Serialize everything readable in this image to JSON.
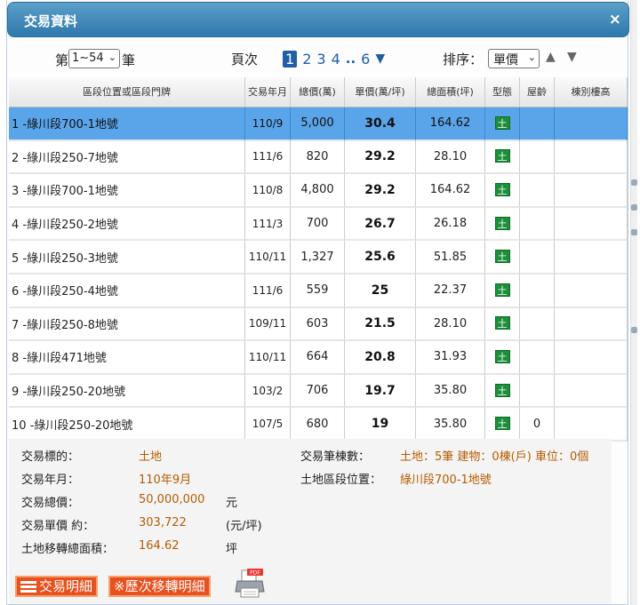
{
  "dialog": {
    "title": "交易資料",
    "close_glyph": "×"
  },
  "pager": {
    "prefix": "第",
    "range_value": "1~54",
    "suffix": "筆",
    "page_label": "頁次",
    "pages": [
      "1",
      "2",
      "3",
      "4",
      "..",
      "6"
    ],
    "current_page": "1",
    "next_glyph": "▼",
    "sort_label": "排序：",
    "sort_value": "單價",
    "sort_up_glyph": "▲",
    "sort_down_glyph": "▼"
  },
  "table": {
    "headers": [
      "區段位置或區段門牌",
      "交易年月",
      "總價(萬)",
      "單價(萬/坪)",
      "總面積(坪)",
      "型態",
      "屋齡",
      "棟別樓高"
    ],
    "rows": [
      {
        "no": "1",
        "addr": "-綠川段700-1地號",
        "ym": "110/9",
        "total": "5,000",
        "unit": "30.4",
        "area": "164.62",
        "type": "土",
        "age": "",
        "floor": ""
      },
      {
        "no": "2",
        "addr": "-綠川段250-7地號",
        "ym": "111/6",
        "total": "820",
        "unit": "29.2",
        "area": "28.10",
        "type": "土",
        "age": "",
        "floor": ""
      },
      {
        "no": "3",
        "addr": "-綠川段700-1地號",
        "ym": "110/8",
        "total": "4,800",
        "unit": "29.2",
        "area": "164.62",
        "type": "土",
        "age": "",
        "floor": ""
      },
      {
        "no": "4",
        "addr": "-綠川段250-2地號",
        "ym": "111/3",
        "total": "700",
        "unit": "26.7",
        "area": "26.18",
        "type": "土",
        "age": "",
        "floor": ""
      },
      {
        "no": "5",
        "addr": "-綠川段250-3地號",
        "ym": "110/11",
        "total": "1,327",
        "unit": "25.6",
        "area": "51.85",
        "type": "土",
        "age": "",
        "floor": ""
      },
      {
        "no": "6",
        "addr": "-綠川段250-4地號",
        "ym": "111/6",
        "total": "559",
        "unit": "25",
        "area": "22.37",
        "type": "土",
        "age": "",
        "floor": ""
      },
      {
        "no": "7",
        "addr": "-綠川段250-8地號",
        "ym": "109/11",
        "total": "603",
        "unit": "21.5",
        "area": "28.10",
        "type": "土",
        "age": "",
        "floor": ""
      },
      {
        "no": "8",
        "addr": "-綠川段471地號",
        "ym": "110/11",
        "total": "664",
        "unit": "20.8",
        "area": "31.93",
        "type": "土",
        "age": "",
        "floor": ""
      },
      {
        "no": "9",
        "addr": "-綠川段250-20地號",
        "ym": "103/2",
        "total": "706",
        "unit": "19.7",
        "area": "35.80",
        "type": "土",
        "age": "",
        "floor": ""
      },
      {
        "no": "10",
        "addr": "-綠川段250-20地號",
        "ym": "107/5",
        "total": "680",
        "unit": "19",
        "area": "35.80",
        "type": "土",
        "age": "0",
        "floor": ""
      }
    ]
  },
  "detail": {
    "target_label": "交易標的：",
    "target_value": "土地",
    "ym_label": "交易年月：",
    "ym_value": "110年9月",
    "total_label": "交易總價：",
    "total_value": "50,000,000",
    "total_unit": "元",
    "unit_label": "交易單價 約：",
    "unit_value": "303,722",
    "unit_unit": "(元/坪)",
    "area_label": "土地移轉總面積：",
    "area_value": "164.62",
    "area_unit": "坪",
    "count_label": "交易筆棟數：",
    "count_value": "土地：5筆 建物：0棟(戶) 車位：0個",
    "location_label": "土地區段位置：",
    "location_value": "綠川段700-1地號"
  },
  "buttons": {
    "detail_label": "交易明細",
    "history_label": "※歷次移轉明細",
    "pdf_badge": "PDF"
  },
  "colors": {
    "title_bar": "#2f79ac",
    "selected_row": "#5aa4ea",
    "accent_orange": "#e8501e",
    "value_orange": "#b55c00",
    "type_green": "#1d8f3a"
  }
}
